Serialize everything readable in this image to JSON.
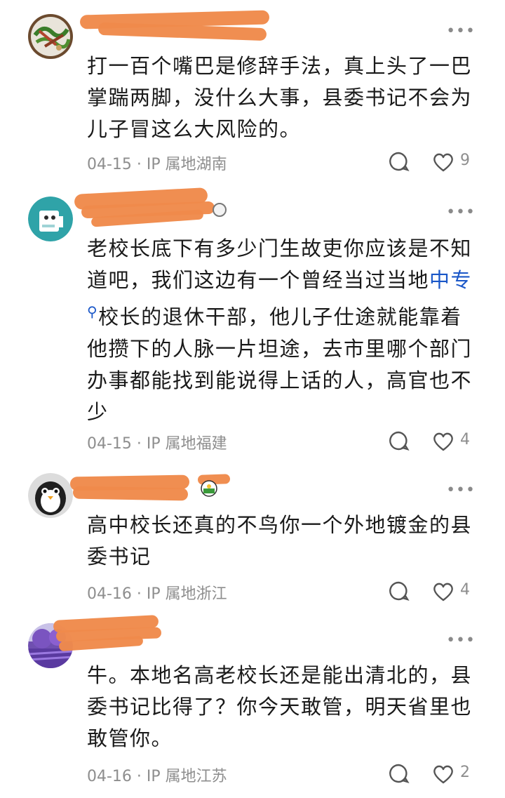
{
  "comments": [
    {
      "body": "打一百个嘴巴是修辞手法，真上头了一巴掌踹两脚，没什么大事，县委书记不会为儿子冒这么大风险的。",
      "date": "04-15",
      "ip": "IP 属地湖南",
      "likes": "9"
    },
    {
      "body_parts": {
        "before": "老校长底下有多少门生故吏你应该是不知道吧，我们这边有一个曾经当过当地",
        "link": "中专",
        "after": "校长的退休干部，他儿子仕途就能靠着他攒下的人脉一片坦途，去市里哪个部门办事都能找到能说得上话的人，高官也不少"
      },
      "date": "04-15",
      "ip": "IP 属地福建",
      "likes": "4"
    },
    {
      "body": "高中校长还真的不鸟你一个外地镀金的县委书记",
      "date": "04-16",
      "ip": "IP 属地浙江",
      "likes": "4"
    },
    {
      "body": "牛。本地名高老校长还是能出清北的，县委书记比得了？你今天敢管，明天省里也敢管你。",
      "date": "04-16",
      "ip": "IP 属地江苏",
      "likes": "2"
    }
  ],
  "separator": " · ",
  "more_label": "•••",
  "colors": {
    "redaction": "#f08a4b",
    "link": "#1a57c8",
    "meta": "#8e8e8e"
  },
  "icons": {
    "reply": "comment-bubble-icon",
    "like": "heart-icon",
    "more": "more-dots-icon",
    "search": "search-icon"
  }
}
